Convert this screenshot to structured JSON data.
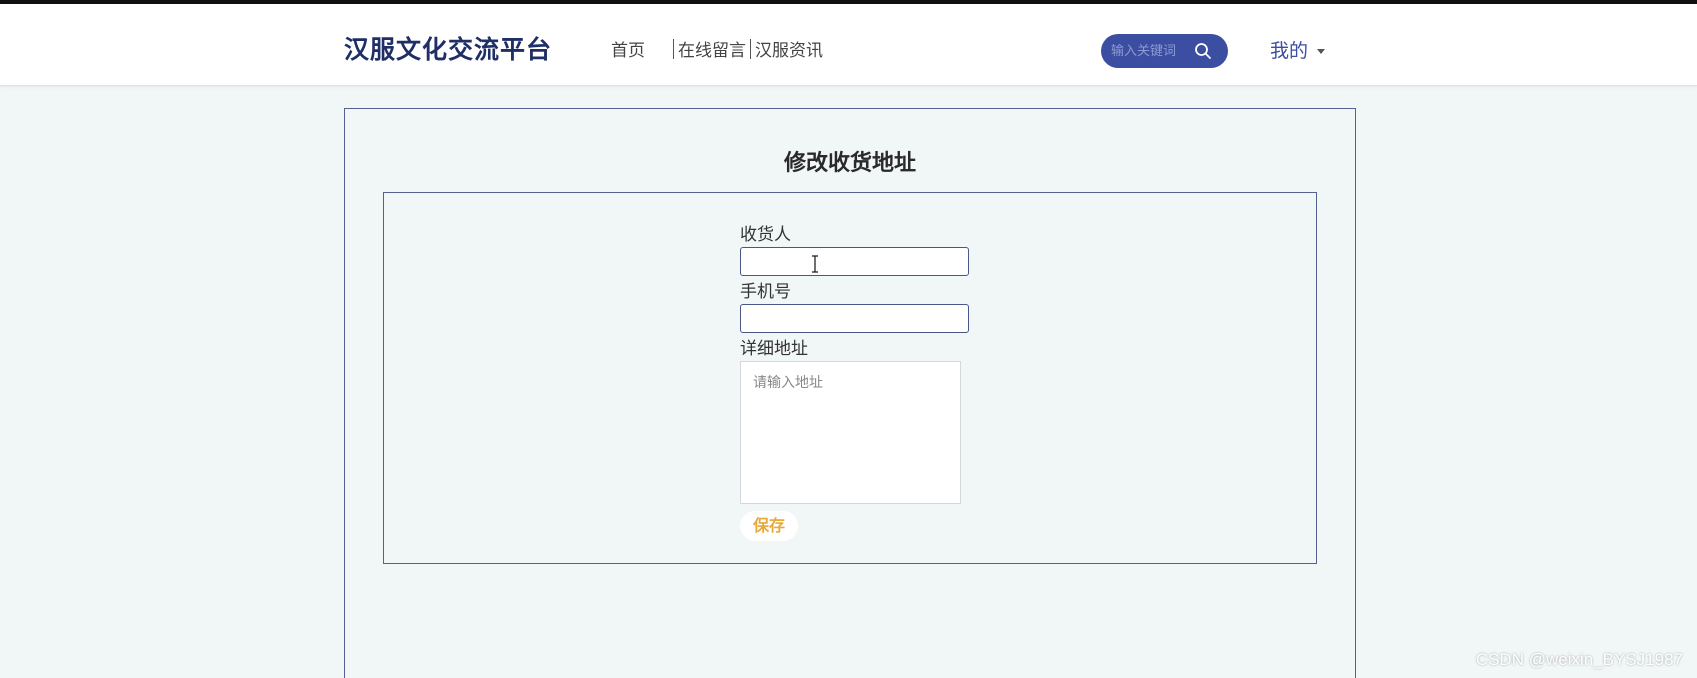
{
  "header": {
    "brand": "汉服文化交流平台",
    "nav": [
      "首页",
      "在线留言",
      "汉服资讯"
    ],
    "search_placeholder": "输入关键词",
    "search_icon": "search-icon",
    "mine_label": "我的"
  },
  "page": {
    "title": "修改收货地址",
    "form": {
      "receiver_label": "收货人",
      "receiver_value": "",
      "phone_label": "手机号",
      "phone_value": "",
      "address_label": "详细地址",
      "address_placeholder": "请输入地址",
      "save_label": "保存"
    }
  },
  "watermark": "CSDN @weixin_BYSJ1987",
  "colors": {
    "brand": "#1f2f66",
    "accent": "#3b4ea2",
    "save": "#e8a83a",
    "background": "#f1f6f7"
  }
}
